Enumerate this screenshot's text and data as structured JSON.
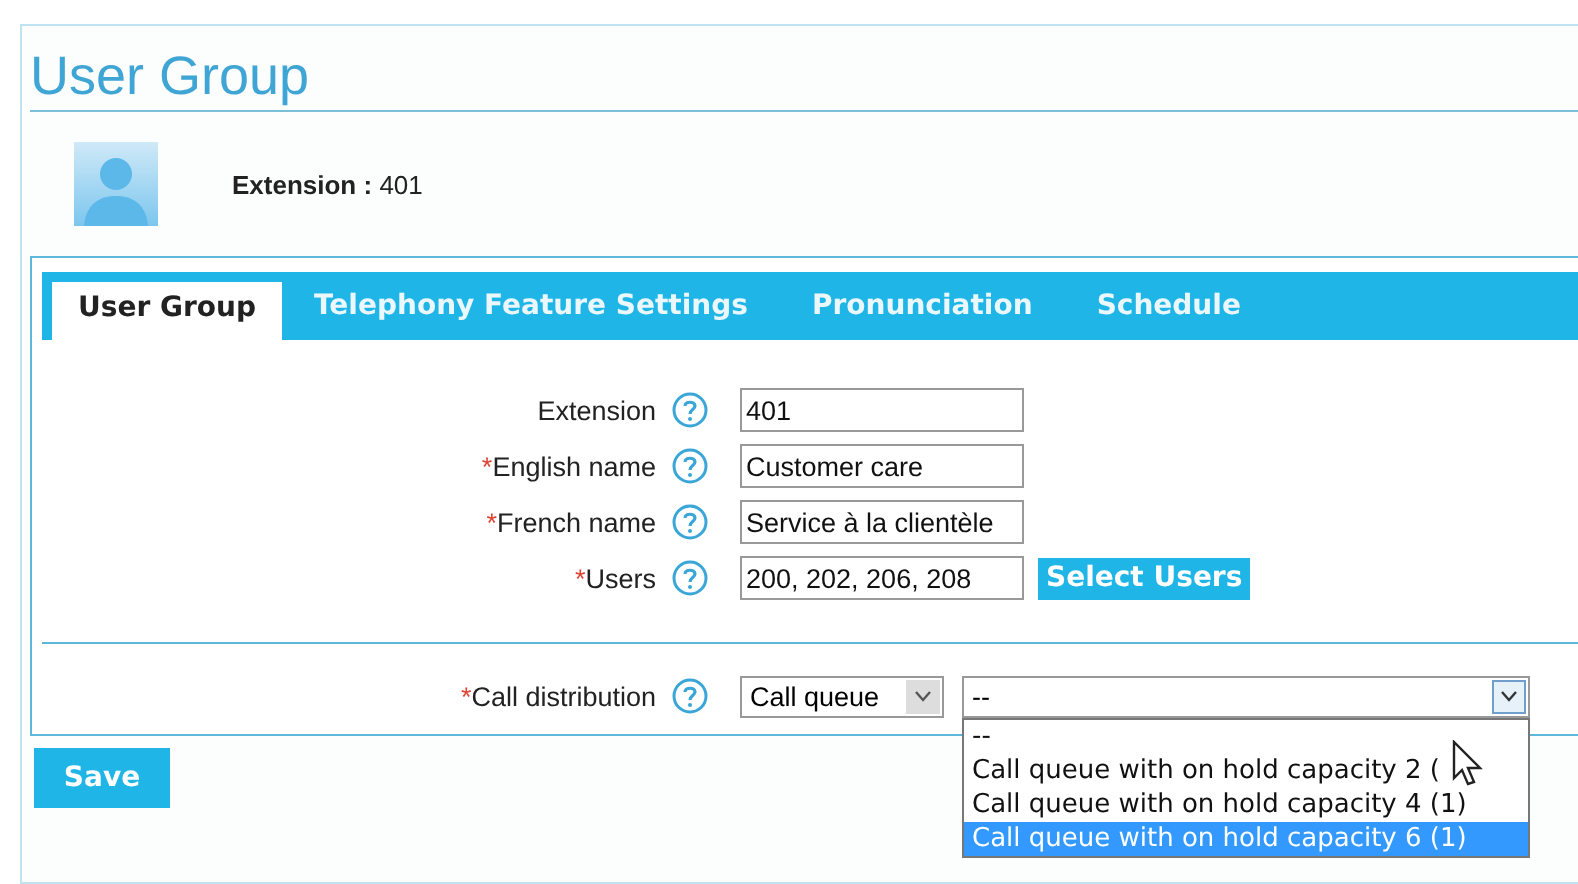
{
  "page_title": "User Group",
  "header": {
    "label": "Extension :",
    "value": "401"
  },
  "tabs": [
    {
      "label": "User Group",
      "selected": true
    },
    {
      "label": "Telephony Feature Settings",
      "selected": false
    },
    {
      "label": "Pronunciation",
      "selected": false
    },
    {
      "label": "Schedule",
      "selected": false
    }
  ],
  "fields": [
    {
      "label": "Extension",
      "value": "401"
    },
    {
      "required_mark": "*",
      "label": "English name",
      "value": "Customer care"
    },
    {
      "required_mark": "*",
      "label": "French name",
      "value": "Service à la clientèle"
    },
    {
      "required_mark": "*",
      "label": "Users",
      "value": "200, 202, 206, 208",
      "button": "Select Users"
    }
  ],
  "call_distribution": {
    "required_mark": "*",
    "label": "Call distribution",
    "type_value": "Call queue",
    "queue_value": "--",
    "options": [
      {
        "label": "--",
        "selected": false
      },
      {
        "label": "Call queue with on hold capacity 2 (",
        "selected": false
      },
      {
        "label": "Call queue with on hold capacity 4 (1)",
        "selected": false
      },
      {
        "label": "Call queue with on hold capacity 6 (1)",
        "selected": true
      }
    ]
  },
  "save_button": "Save"
}
